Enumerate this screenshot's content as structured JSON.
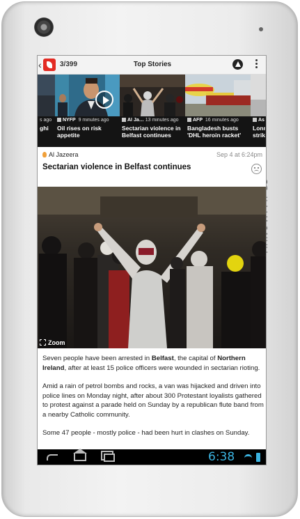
{
  "device": {
    "brand": "ARNOVA",
    "model": "7h G3"
  },
  "actionbar": {
    "back_glyph": "‹",
    "counter": "3/399",
    "title": "Top Stories"
  },
  "carousel": [
    {
      "source": "",
      "time": "s ago",
      "headline": "ghi"
    },
    {
      "source": "NYFP",
      "time": "9 minutes ago",
      "headline": "Oil rises on risk appetite",
      "video": true
    },
    {
      "source": "Al Ja…",
      "time": "13 minutes ago",
      "headline": "Sectarian violence in Belfast continues"
    },
    {
      "source": "AFP",
      "time": "16 minutes ago",
      "headline": "Bangladesh busts 'DHL heroin racket'"
    },
    {
      "source": "As",
      "time": "",
      "headline": "Lonm strike"
    }
  ],
  "article": {
    "source": "Al Jazeera",
    "date": "Sep 4 at 6:24pm",
    "title": "Sectarian violence in Belfast continues",
    "zoom_label": "Zoom",
    "p1_a": "Seven people have been arrested in ",
    "p1_b": "Belfast",
    "p1_c": ", the capital of ",
    "p1_d": "Northern Ireland",
    "p1_e": ", after at least 15 police officers were wounded in sectarian rioting.",
    "p2": "Amid a rain of petrol bombs and rocks, a van was hijacked and driven into police lines on Monday night, after about 300 Protestant loyalists gathered to protest against a parade held on Sunday by a republican flute band from a nearby Catholic community.",
    "p3": "Some 47 people - mostly police - had been hurt in clashes on Sunday."
  },
  "statusbar": {
    "time": "6:38"
  },
  "colors": {
    "accent": "#3bb3e0",
    "brand_red": "#e32b23"
  }
}
